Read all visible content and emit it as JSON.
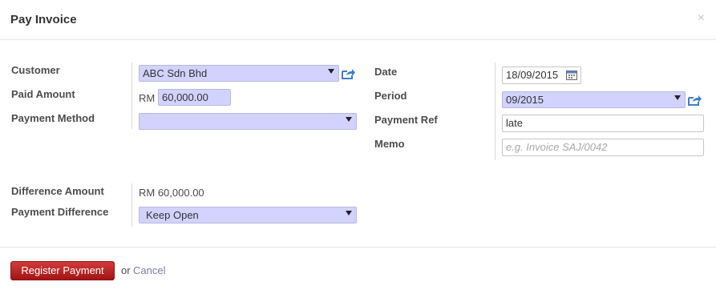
{
  "dialog": {
    "title": "Pay Invoice",
    "close_icon": "×"
  },
  "left": {
    "customer_label": "Customer",
    "customer_value": "ABC Sdn Bhd",
    "paid_amount_label": "Paid Amount",
    "currency": "RM",
    "paid_amount_value": "60,000.00",
    "payment_method_label": "Payment Method",
    "payment_method_value": ""
  },
  "right": {
    "date_label": "Date",
    "date_value": "18/09/2015",
    "period_label": "Period",
    "period_value": "09/2015",
    "payment_ref_label": "Payment Ref",
    "payment_ref_value": "late",
    "memo_label": "Memo",
    "memo_placeholder": "e.g. Invoice SAJ/0042"
  },
  "difference": {
    "amount_label": "Difference Amount",
    "amount_value": "RM 60,000.00",
    "payment_difference_label": "Payment Difference",
    "payment_difference_value": "Keep Open"
  },
  "footer": {
    "register_label": "Register Payment",
    "or_text": "or",
    "cancel_label": "Cancel"
  },
  "colors": {
    "field_highlight": "#d2d2ff",
    "primary_button": "#b71c1c",
    "link": "#7c7bad",
    "icon_blue": "#3d7fc9"
  }
}
